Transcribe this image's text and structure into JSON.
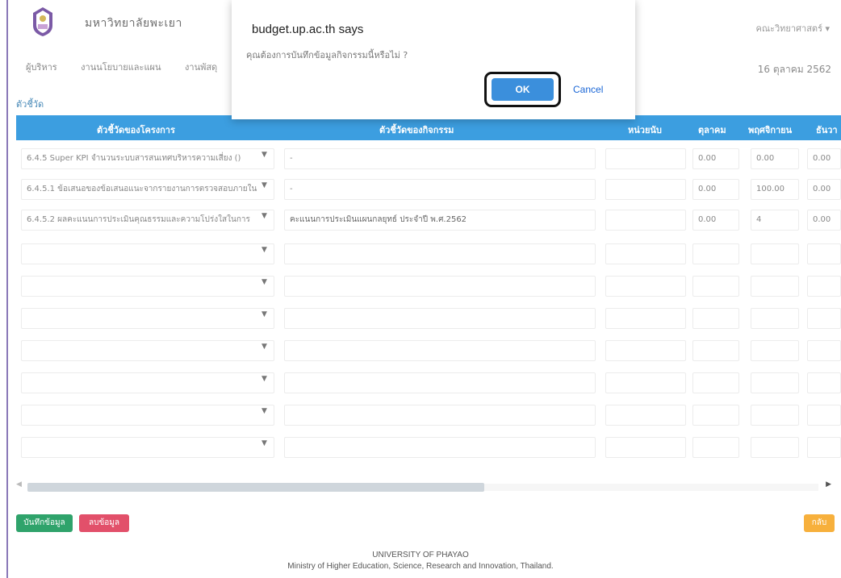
{
  "header": {
    "university_name": "มหาวิทยาลัยพะเยา",
    "faculty": "คณะวิทยาศาสตร์ ▾",
    "date": "16 ตุลาคม 2562",
    "nav": [
      "ผู้บริหาร",
      "งานนโยบายและแผน",
      "งานพัสดุ"
    ]
  },
  "section_label": "ตัวชี้วัด",
  "table": {
    "headers": {
      "project_indicator": "ตัวชี้วัดของโครงการ",
      "activity_indicator": "ตัวชี้วัดของกิจกรรม",
      "unit": "หน่วยนับ",
      "oct": "ตุลาคม",
      "nov": "พฤศจิกายน",
      "dec": "ธันวา"
    },
    "rows": [
      {
        "project": "6.4.5 Super KPI จำนวนระบบสารสนเทศบริหารความเสี่ยง ()",
        "activity": "-",
        "unit": "",
        "oct": "0.00",
        "nov": "0.00",
        "dec": "0.00"
      },
      {
        "project": "6.4.5.1 ข้อเสนอของข้อเสนอแนะจากรายงานการตรวจสอบภายใน",
        "activity": "-",
        "unit": "",
        "oct": "0.00",
        "nov": "100.00",
        "dec": "0.00"
      },
      {
        "project": "6.4.5.2 ผลคะแนนการประเมินคุณธรรมและความโปร่งใสในการ",
        "activity": "คะแนนการประเมินแผนกลยุทธ์ ประจำปี พ.ศ.2562",
        "unit": "",
        "oct": "0.00",
        "nov": "4",
        "dec": "0.00"
      },
      {
        "project": "",
        "activity": "",
        "unit": "",
        "oct": "",
        "nov": "",
        "dec": ""
      },
      {
        "project": "",
        "activity": "",
        "unit": "",
        "oct": "",
        "nov": "",
        "dec": ""
      },
      {
        "project": "",
        "activity": "",
        "unit": "",
        "oct": "",
        "nov": "",
        "dec": ""
      },
      {
        "project": "",
        "activity": "",
        "unit": "",
        "oct": "",
        "nov": "",
        "dec": ""
      },
      {
        "project": "",
        "activity": "",
        "unit": "",
        "oct": "",
        "nov": "",
        "dec": ""
      },
      {
        "project": "",
        "activity": "",
        "unit": "",
        "oct": "",
        "nov": "",
        "dec": ""
      },
      {
        "project": "",
        "activity": "",
        "unit": "",
        "oct": "",
        "nov": "",
        "dec": ""
      }
    ]
  },
  "buttons": {
    "save": "บันทึกข้อมูล",
    "delete": "ลบข้อมูล",
    "back": "กลับ"
  },
  "footer": {
    "line1": "UNIVERSITY OF PHAYAO",
    "line2": "Ministry of Higher Education, Science, Research and Innovation, Thailand."
  },
  "dialog": {
    "title": "budget.up.ac.th says",
    "message": "คุณต้องการบันทึกข้อมูลกิจกรรมนี้หรือไม่ ?",
    "ok_label": "OK",
    "cancel_label": "Cancel"
  },
  "colors": {
    "header_bar": "#3c9ee0",
    "save": "#2fa36b",
    "delete": "#e2506a",
    "back": "#f7b03c",
    "ok": "#3b8fdc"
  }
}
